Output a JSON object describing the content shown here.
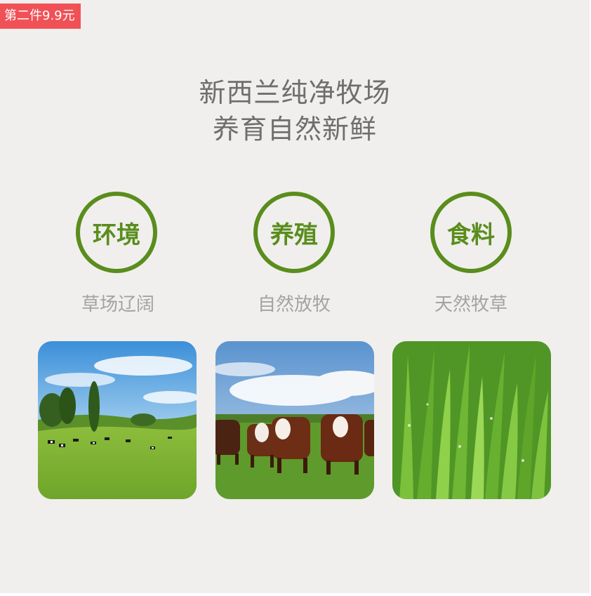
{
  "promo_badge": {
    "text": "第二件9.9元",
    "color": "#f05156"
  },
  "headline": {
    "line1": "新西兰纯净牧场",
    "line2": "养育自然新鲜"
  },
  "features": [
    {
      "title": "环境",
      "subtitle": "草场辽阔",
      "photo": "pasture-with-cows-and-trees"
    },
    {
      "title": "养殖",
      "subtitle": "自然放牧",
      "photo": "hereford-cattle-herd"
    },
    {
      "title": "食料",
      "subtitle": "天然牧草",
      "photo": "green-grass-closeup"
    }
  ],
  "colors": {
    "background": "#f0efed",
    "accent_green": "#5a8d1d",
    "headline_gray": "#6e6e6e",
    "subtitle_gray": "#a3a3a3"
  }
}
